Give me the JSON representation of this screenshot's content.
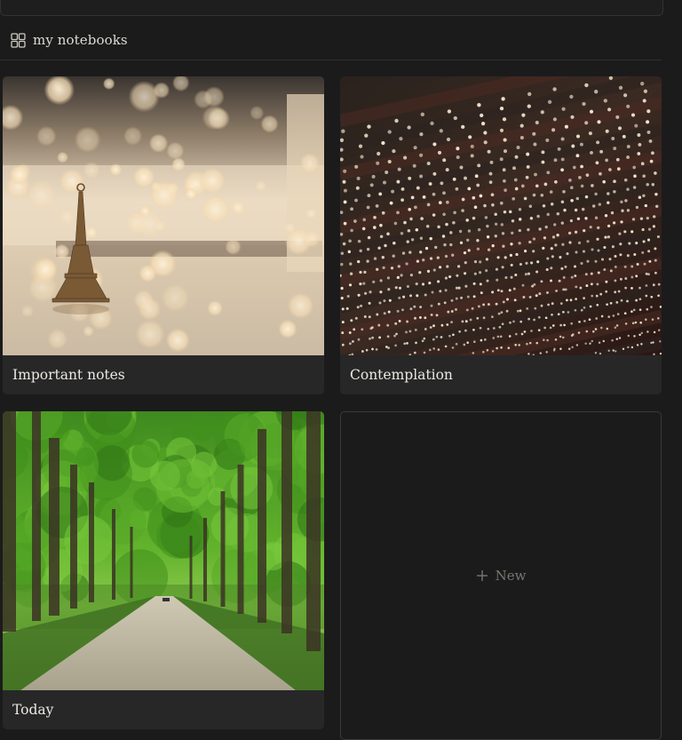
{
  "section": {
    "icon": "grid-icon",
    "title": "my notebooks"
  },
  "notebooks": [
    {
      "title": "Important notes",
      "cover": "eiffel-tower-bokeh-photo"
    },
    {
      "title": "Contemplation",
      "cover": "string-lights-ceiling-photo"
    },
    {
      "title": "Today",
      "cover": "tree-lined-road-photo"
    }
  ],
  "new_card": {
    "icon": "plus-icon",
    "label": "New"
  }
}
